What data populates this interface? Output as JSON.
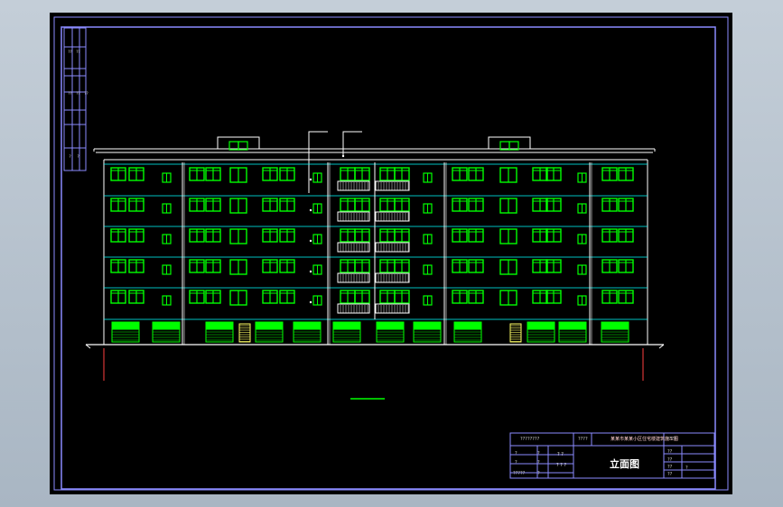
{
  "drawing": {
    "view_title": "立面图",
    "title_block": {
      "project": "某某市某某小区住宅楼建筑施工图",
      "code_top_left": "????????",
      "code_top_mid": "????",
      "code_top_right": "????",
      "row_labels": [
        "?",
        "?",
        "?????"
      ],
      "row_values": [
        "?",
        "?",
        "?"
      ],
      "small_fields": [
        "??",
        "??",
        "??",
        "??",
        "?"
      ],
      "stamps": [
        "? ?",
        "? ? ?"
      ]
    },
    "side_strip_labels": [
      "??",
      "??",
      "??",
      "??",
      "??",
      "?",
      "?"
    ],
    "floors": 6
  },
  "colors": {
    "background": "#000000",
    "frame": "#8b8bff",
    "window": "#00ff00",
    "line": "#ffffff",
    "floor_line": "#00ffff",
    "shutter": "#00ff00",
    "stair": "#ffff66"
  },
  "icons": [
    "window-icon",
    "balcony-railing-icon",
    "rolling-shutter-icon"
  ]
}
